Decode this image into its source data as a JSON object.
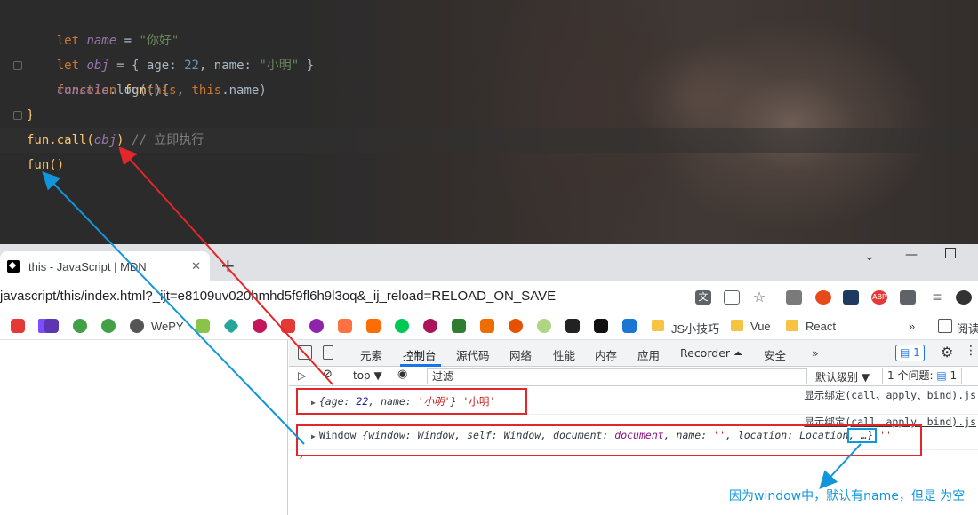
{
  "editor": {
    "line1": {
      "kw": "let",
      "name": "name",
      "eq": " = ",
      "str": "\"你好\""
    },
    "line2": {
      "kw": "let",
      "name": "obj",
      "eq": " = { ",
      "k1": "age",
      "c1": ": ",
      "v1": "22",
      "sep": ", ",
      "k2": "name",
      "c2": ": ",
      "v2": "\"小明\"",
      "end": " }"
    },
    "line3": {
      "kw": "function",
      "fn": "fun",
      "rest": "(){"
    },
    "line4": {
      "obj": "console",
      "dot": ".log(",
      "this1": "this",
      "sep": ", ",
      "this2": "this",
      "prop": ".name)"
    },
    "line5": "}",
    "line6": {
      "call": "fun.call(",
      "arg": "obj",
      "close": ")",
      "comment": " // 立即执行"
    },
    "line7": "fun()"
  },
  "browser": {
    "tab_title": "this - JavaScript | MDN",
    "tab_close": "✕",
    "new_tab": "+",
    "url": "javascript/this/index.html?_ijt=e8109uv020hmhd5f9fl6h9l3oq&_ij_reload=RELOAD_ON_SAVE",
    "bookmarks": {
      "wepy": "WePY",
      "js_tips": "JS小技巧",
      "vue": "Vue",
      "react": "React",
      "more": "»",
      "reading": "阅读"
    }
  },
  "devtools": {
    "tabs": [
      "元素",
      "控制台",
      "源代码",
      "网络",
      "性能",
      "内存",
      "应用",
      "Recorder ⏶",
      "安全",
      "»"
    ],
    "active_tab": "控制台",
    "msg_count": "1",
    "toolbar": {
      "context": "top ▼",
      "filter_placeholder": "过滤",
      "level": "默认级别 ▼",
      "issues": "1 个问题: ",
      "issues_count": "1"
    },
    "console": {
      "row1": {
        "open": "{",
        "k1": "age",
        "v1": "22",
        "k2": "name",
        "v2": "'小明'",
        "close": "}",
        "extra": "'小明'"
      },
      "row1_source": "显示绑定(call、apply、bind).js",
      "row2_source": "显示绑定(call、apply、bind).js",
      "row2": {
        "label": "Window",
        "body_open": "{",
        "f1k": "window",
        "f1v": "Window",
        "f2k": "self",
        "f2v": "Window",
        "f3k": "document",
        "f3v": "document",
        "f4k": "name",
        "f4v": "''",
        "f5k": "location",
        "f5v": "Location",
        "tail": ", …}",
        "extra": "''"
      },
      "prompt": "›"
    }
  },
  "annotation": {
    "note": "因为window中，默认有name，但是 为空",
    "red": "#e3262a",
    "blue": "#1296db"
  }
}
